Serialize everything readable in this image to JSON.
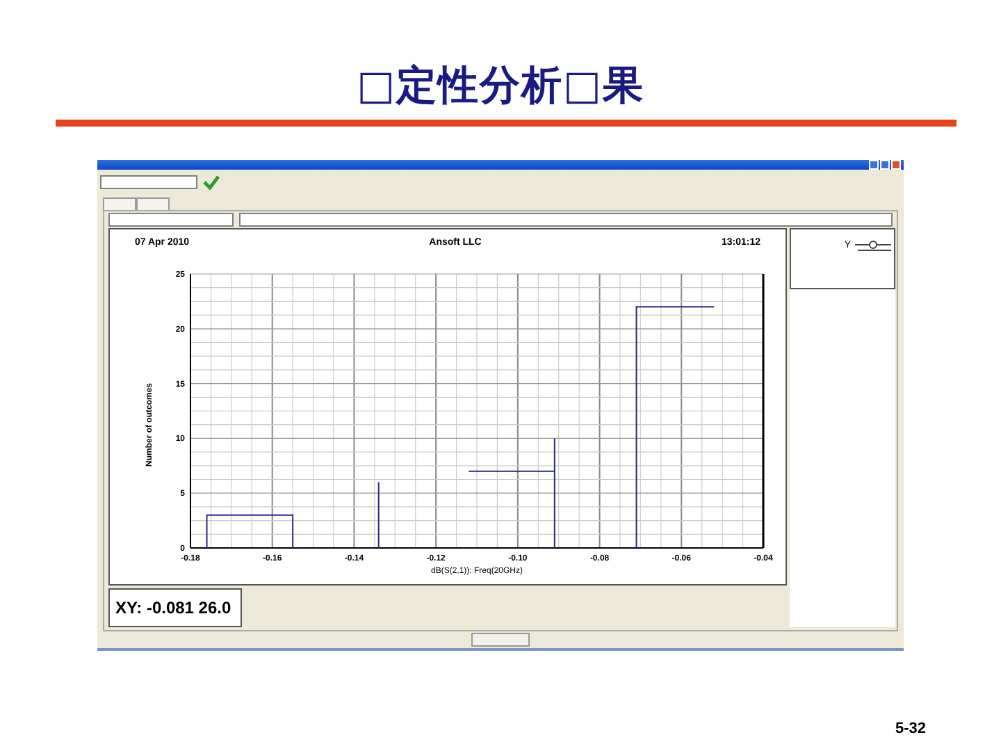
{
  "slide_title": "□定性分析□果",
  "plot": {
    "date": "07 Apr 2010",
    "company": "Ansoft LLC",
    "time": "13:01:12",
    "chart_data": {
      "type": "line",
      "xlabel": "dB(S(2,1)): Freq(20GHz)",
      "ylabel": "Number of outcomes",
      "xlim": [
        -0.18,
        -0.04
      ],
      "ylim": [
        0,
        25
      ],
      "xticks": [
        -0.18,
        -0.16,
        -0.14,
        -0.12,
        {
          "value": -0.1,
          "label": "-0.10"
        },
        -0.08,
        -0.06,
        -0.04
      ],
      "yticks": [
        0,
        5,
        10,
        15,
        20,
        25
      ],
      "grid": true,
      "x": [
        -0.176,
        -0.176,
        -0.155,
        -0.155,
        null,
        -0.134,
        -0.134,
        null,
        -0.112,
        -0.091,
        -0.091,
        -0.091,
        null,
        -0.071,
        -0.071,
        -0.052
      ],
      "series": [
        {
          "name": "Y",
          "color": "#2a2a8c",
          "values": [
            0,
            3,
            3,
            0,
            null,
            0,
            6,
            null,
            7,
            7,
            10,
            0,
            null,
            0,
            22,
            22
          ]
        }
      ]
    }
  },
  "readout": "XY: -0.081 26.0",
  "page_number": "5-32"
}
